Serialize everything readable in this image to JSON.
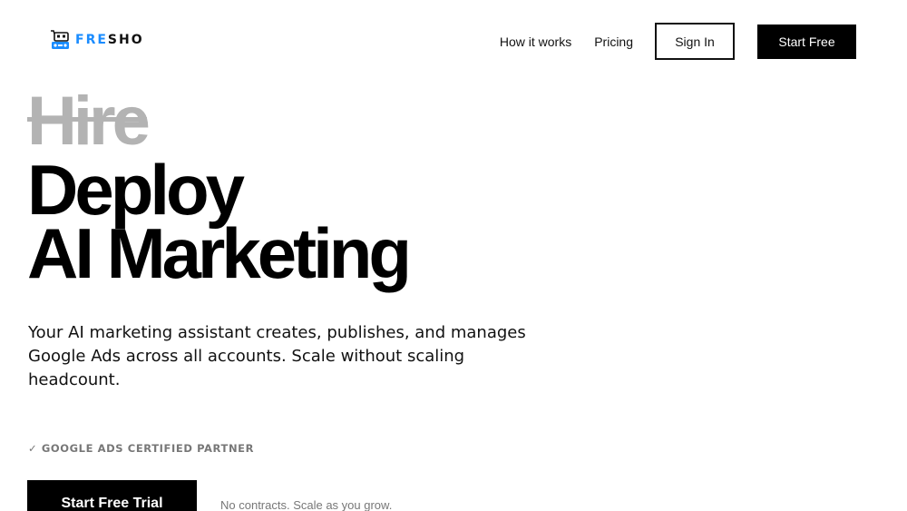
{
  "brand": {
    "name_part1": "FRE",
    "name_part2": "SHO",
    "logo_icon": "cart-robot-icon",
    "accent_color": "#1a8cff"
  },
  "nav": {
    "how_it_works": "How it works",
    "pricing": "Pricing",
    "sign_in": "Sign In",
    "start_free": "Start Free"
  },
  "hero": {
    "struck_word": "Hire",
    "line1": "Deploy",
    "line2": "AI Marketing",
    "subtitle": "Your AI marketing assistant creates, publishes, and manages Google Ads across all accounts. Scale without scaling headcount."
  },
  "badge": {
    "certified": "✓ GOOGLE ADS CERTIFIED PARTNER"
  },
  "cta": {
    "start_trial": "Start Free Trial",
    "note": "No contracts. Scale as you grow."
  }
}
